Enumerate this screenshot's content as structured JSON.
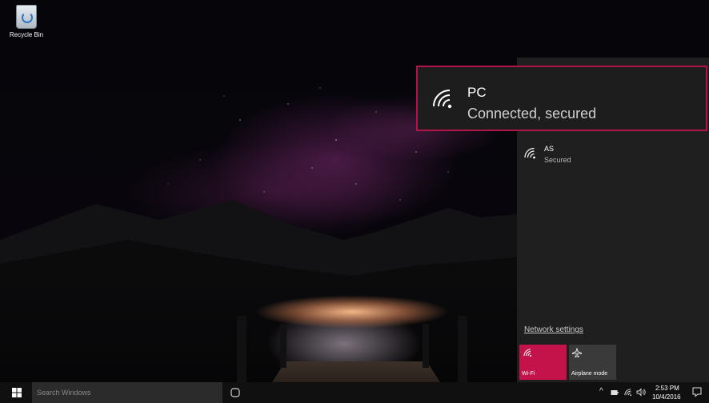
{
  "desktop": {
    "recycle_bin_label": "Recycle Bin"
  },
  "network_flyout": {
    "networks": [
      {
        "name": "PC",
        "status": "Connected, secured",
        "icon": "wifi-icon",
        "highlighted": true
      },
      {
        "name": "AS",
        "status": "Secured",
        "icon": "wifi-icon",
        "highlighted": false
      }
    ],
    "settings_link": "Network settings",
    "tiles": [
      {
        "label": "Wi-Fi",
        "icon": "wifi-icon",
        "active": true,
        "color": "#c4134a"
      },
      {
        "label": "Airplane mode",
        "icon": "airplane-icon",
        "active": false,
        "color": "#3a3a3a"
      }
    ],
    "highlight_color": "#b01448"
  },
  "taskbar": {
    "search_placeholder": "Search Windows",
    "clock": {
      "time": "2:53 PM",
      "date": "10/4/2016"
    }
  }
}
